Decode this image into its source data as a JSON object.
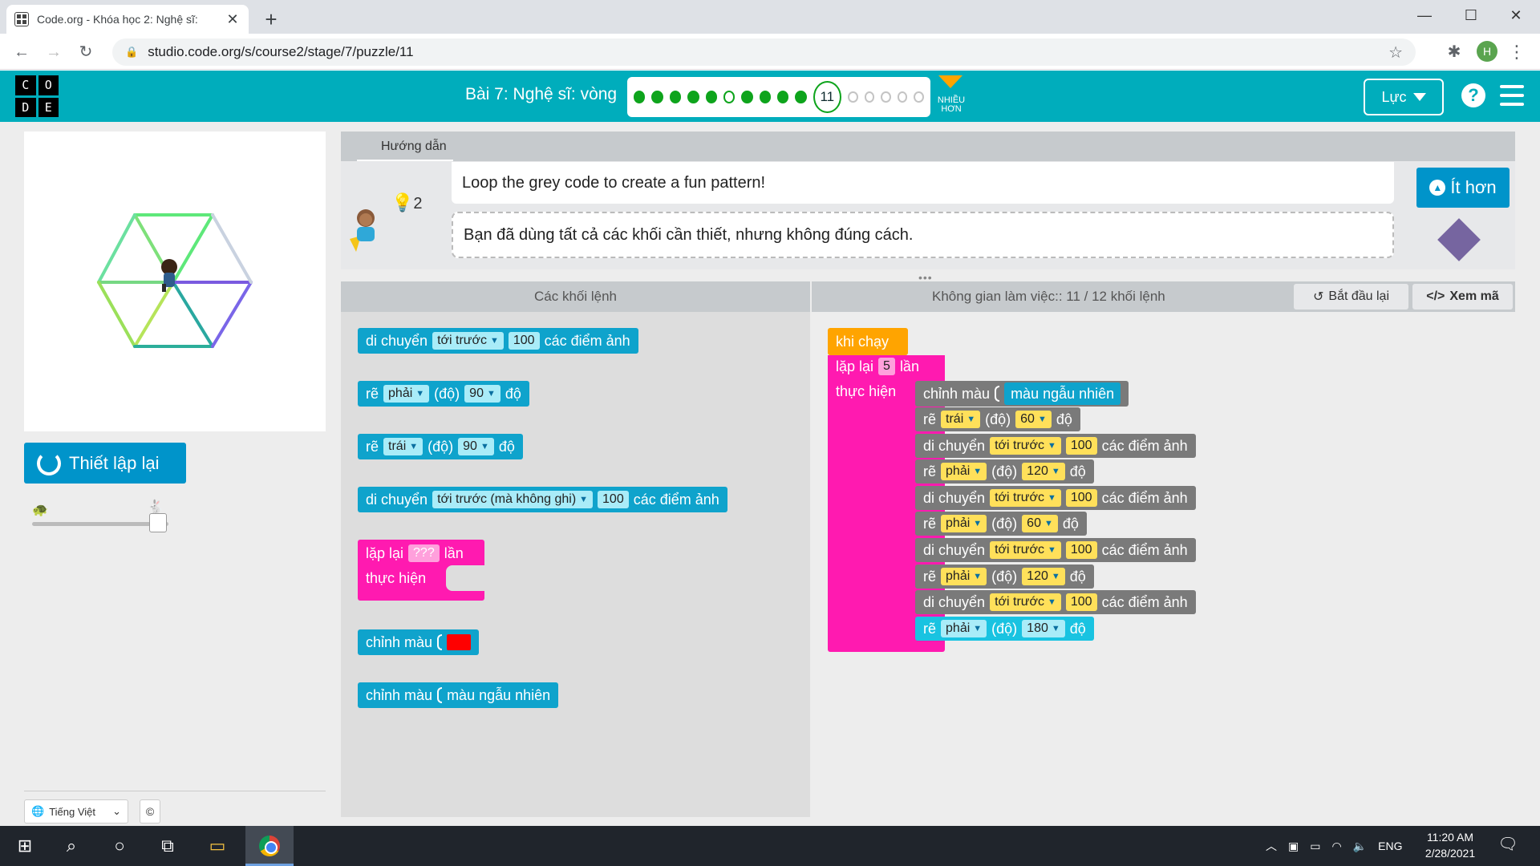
{
  "browser": {
    "tab_title": "Code.org - Khóa học 2: Nghệ sĩ: ",
    "tab_close": "✕",
    "new_tab": "+",
    "url": "studio.code.org/s/course2/stage/7/puzzle/11",
    "profile_initial": "H",
    "win_minimize": "—",
    "win_maximize": "☐",
    "win_close": "✕"
  },
  "header": {
    "logo_letters": [
      "C",
      "O",
      "D",
      "E"
    ],
    "lesson_title": "Bài 7: Nghệ sĩ: vòng",
    "progress": {
      "before": [
        "done",
        "done",
        "done",
        "done",
        "done",
        "ring",
        "done",
        "done",
        "done",
        "done"
      ],
      "current": "11",
      "after": [
        "empty",
        "empty",
        "empty",
        "empty",
        "empty"
      ]
    },
    "more_label_1": "NHIỀU",
    "more_label_2": "HƠN",
    "level_button": "Lực",
    "help": "?"
  },
  "left": {
    "reset_label": "Thiết lập lại",
    "language": "Tiếng Việt",
    "copyright": "©"
  },
  "instructions": {
    "tab_label": "Hướng dẫn",
    "line1": "Loop the grey code to create a fun pattern!",
    "line2": "Bạn đã dùng tất cả các khối cần thiết, nhưng không đúng cách.",
    "hint_count": "2",
    "less_button": "Ít hơn"
  },
  "toolbox": {
    "header": "Các khối lệnh",
    "blocks": {
      "b1": {
        "kw": "di chuyển",
        "dir": "tới trước",
        "val": "100",
        "tail": "các điểm ảnh"
      },
      "b2": {
        "kw": "rẽ",
        "dir": "phải",
        "mid": "(độ)",
        "val": "90",
        "tail": "độ"
      },
      "b3": {
        "kw": "rẽ",
        "dir": "trái",
        "mid": "(độ)",
        "val": "90",
        "tail": "độ"
      },
      "b4": {
        "kw": "di chuyển",
        "dir": "tới trước (mà không ghi)",
        "val": "100",
        "tail": "các điểm ảnh"
      },
      "b5": {
        "kw": "lặp lại",
        "val": "???",
        "tail": "lần",
        "do": "thực hiện"
      },
      "b6": {
        "kw": "chỉnh màu"
      },
      "b7": {
        "kw": "chỉnh màu",
        "val": "màu ngẫu nhiên"
      }
    }
  },
  "workspace": {
    "header": "Không gian làm việc:: 11 / 12 khối lệnh",
    "restart": "Bắt đầu lại",
    "view_code": "Xem mã",
    "when_run": "khi chạy",
    "repeat": {
      "kw": "lặp lại",
      "val": "5",
      "tail": "lần",
      "do": "thực hiện"
    },
    "setcolor": {
      "kw": "chỉnh màu",
      "val": "màu ngẫu nhiên"
    },
    "rows": [
      {
        "kw": "rẽ",
        "dir": "trái",
        "mid": "(độ)",
        "val": "60",
        "tail": "độ"
      },
      {
        "kw": "di chuyển",
        "dir": "tới trước",
        "val": "100",
        "tail": "các điểm ảnh"
      },
      {
        "kw": "rẽ",
        "dir": "phải",
        "mid": "(độ)",
        "val": "120",
        "tail": "độ"
      },
      {
        "kw": "di chuyển",
        "dir": "tới trước",
        "val": "100",
        "tail": "các điểm ảnh"
      },
      {
        "kw": "rẽ",
        "dir": "phải",
        "mid": "(độ)",
        "val": "60",
        "tail": "độ"
      },
      {
        "kw": "di chuyển",
        "dir": "tới trước",
        "val": "100",
        "tail": "các điểm ảnh"
      },
      {
        "kw": "rẽ",
        "dir": "phải",
        "mid": "(độ)",
        "val": "120",
        "tail": "độ"
      },
      {
        "kw": "di chuyển",
        "dir": "tới trước",
        "val": "100",
        "tail": "các điểm ảnh"
      },
      {
        "kw": "rẽ",
        "dir": "phải",
        "mid": "(độ)",
        "val": "180",
        "tail": "độ"
      }
    ]
  },
  "taskbar": {
    "lang": "ENG",
    "time": "11:20 AM",
    "date": "2/28/2021"
  },
  "colors": {
    "header_teal": "#00adbc",
    "block_cyan": "#19c3e1",
    "block_grey": "#7a7a7a",
    "block_pink": "#ff1ab0",
    "block_orange": "#ffa400",
    "progress_green": "#0ea41c"
  }
}
